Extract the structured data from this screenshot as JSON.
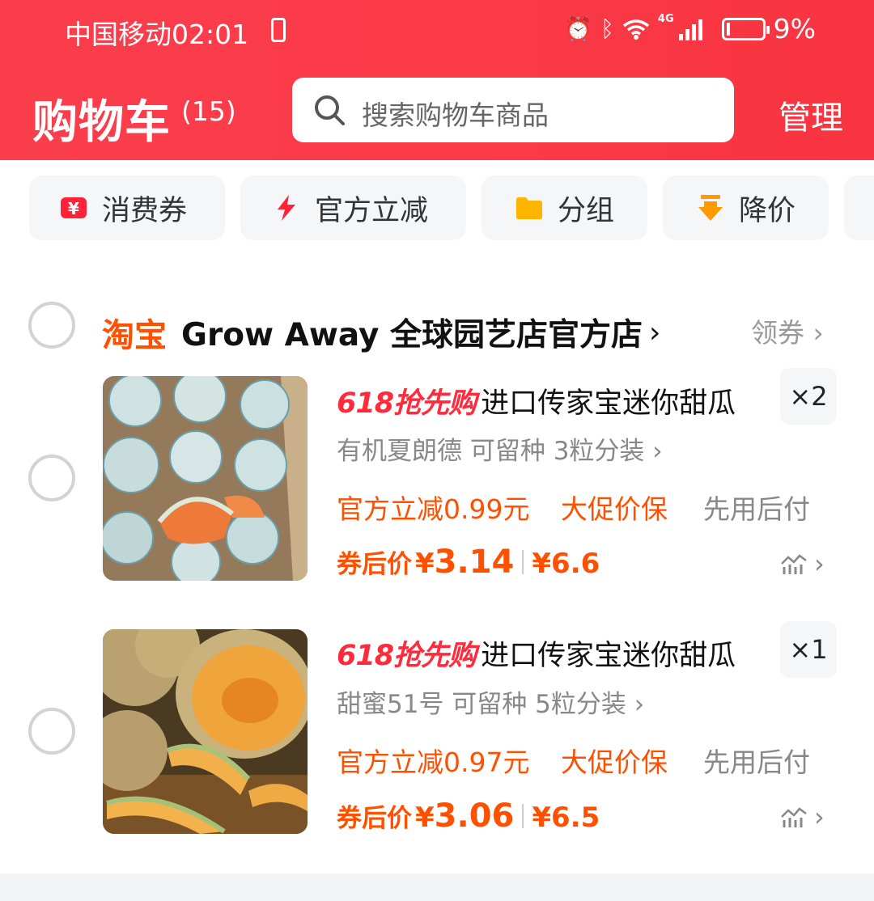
{
  "status": {
    "carrier": "中国移动",
    "time": "02:01",
    "battery": "9%",
    "network": "4G"
  },
  "header": {
    "title": "购物车",
    "count": "(15)",
    "search_placeholder": "搜索购物车商品",
    "manage": "管理"
  },
  "chips": [
    {
      "label": "消费券",
      "icon": "coupon-icon"
    },
    {
      "label": "官方立减",
      "icon": "lightning-icon"
    },
    {
      "label": "分组",
      "icon": "folder-icon"
    },
    {
      "label": "降价",
      "icon": "price-down-icon"
    }
  ],
  "store": {
    "platform": "淘宝",
    "name": "Grow Away 全球园艺店官方店",
    "coupon": "领券"
  },
  "items": [
    {
      "promo": "618抢先购",
      "title": "进口传家宝迷你甜瓜",
      "qty": "×2",
      "variant": "有机夏朗德 可留种 3粒分装",
      "tag1": "官方立减0.99元",
      "tag2": "大促价保",
      "tag3": "先用后付",
      "price_label": "券后价",
      "price": "3.14",
      "orig_price": "¥6.6"
    },
    {
      "promo": "618抢先购",
      "title": "进口传家宝迷你甜瓜",
      "qty": "×1",
      "variant": "甜蜜51号 可留种 5粒分装",
      "tag1": "官方立减0.97元",
      "tag2": "大促价保",
      "tag3": "先用后付",
      "price_label": "券后价",
      "price": "3.06",
      "orig_price": "¥6.5"
    }
  ],
  "colors": {
    "brand": "#fb3e4c",
    "taobao": "#ff5000",
    "promo": "#ff2b3c"
  }
}
